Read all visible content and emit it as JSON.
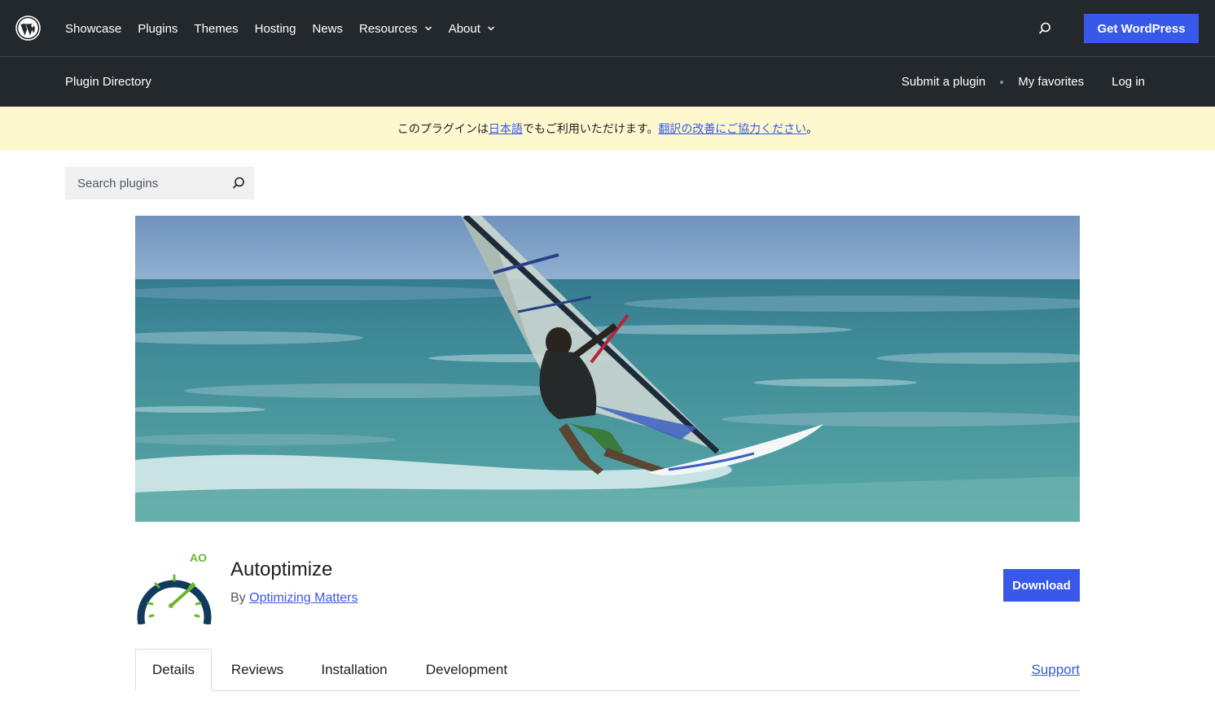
{
  "global_nav": {
    "logo_icon": "wordpress-logo-icon",
    "items": [
      {
        "label": "Showcase",
        "dropdown": false
      },
      {
        "label": "Plugins",
        "dropdown": false
      },
      {
        "label": "Themes",
        "dropdown": false
      },
      {
        "label": "Hosting",
        "dropdown": false
      },
      {
        "label": "News",
        "dropdown": false
      },
      {
        "label": "Resources",
        "dropdown": true
      },
      {
        "label": "About",
        "dropdown": true
      }
    ],
    "search_icon": "search-icon",
    "cta_label": "Get WordPress"
  },
  "local_nav": {
    "title": "Plugin Directory",
    "submit_label": "Submit a plugin",
    "favorites_label": "My favorites",
    "login_label": "Log in"
  },
  "notice": {
    "prefix": "このプラグインは",
    "language_link": "日本語",
    "middle": "でもご利用いただけます。",
    "help_link": "翻訳の改善にご協力ください",
    "suffix": "。"
  },
  "search": {
    "placeholder": "Search plugins",
    "icon": "search-icon"
  },
  "plugin": {
    "icon_text": "AO",
    "title": "Autoptimize",
    "by_prefix": "By",
    "author": "Optimizing Matters",
    "download_label": "Download"
  },
  "tabs": {
    "items": [
      "Details",
      "Reviews",
      "Installation",
      "Development"
    ],
    "active": "Details",
    "support_label": "Support"
  },
  "colors": {
    "header_bg": "#23282d",
    "accent": "#3858e9",
    "notice_bg": "#fef8cf",
    "icon_green": "#6cb82b",
    "icon_navy": "#103b5c"
  }
}
